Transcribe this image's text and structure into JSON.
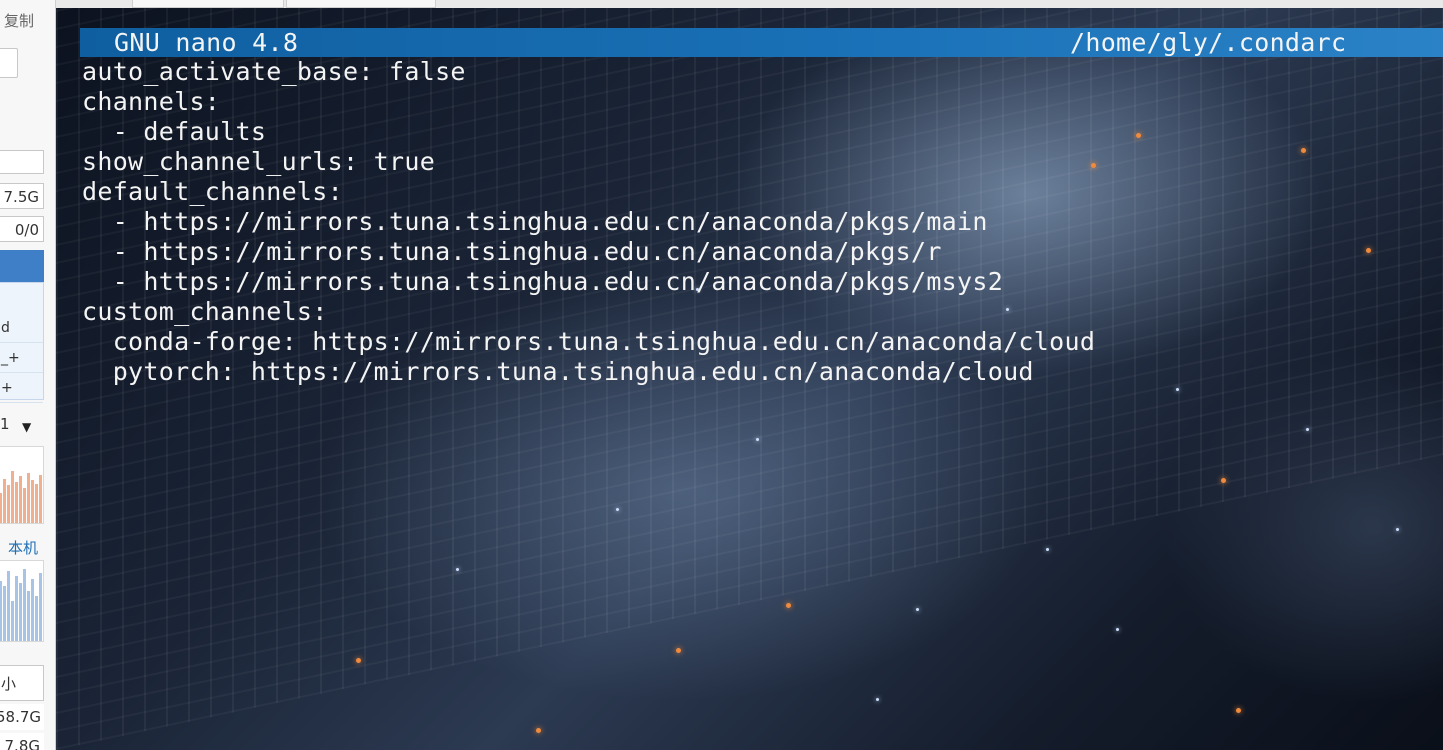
{
  "side_panel": {
    "copy_label": "复制",
    "memory_value": "7.5G",
    "io_value": "0/0",
    "rows": [
      "d",
      "_+",
      "+"
    ],
    "cpu_label": "1",
    "local_label": "本机",
    "disk_header": "小",
    "disk_values": [
      "58.7G",
      "7.8G"
    ],
    "colors": {
      "selected_row": "#3f7fc8",
      "cpu_graph": "#f0b090",
      "net_graph": "#a7c4e6"
    }
  },
  "terminal": {
    "titlebar": {
      "app": "GNU nano 4.8",
      "file": "/home/gly/.condarc",
      "color": "#1b72b8"
    },
    "lines": [
      "auto_activate_base: false",
      "channels:",
      "  - defaults",
      "show_channel_urls: true",
      "default_channels:",
      "  - https://mirrors.tuna.tsinghua.edu.cn/anaconda/pkgs/main",
      "  - https://mirrors.tuna.tsinghua.edu.cn/anaconda/pkgs/r",
      "  - https://mirrors.tuna.tsinghua.edu.cn/anaconda/pkgs/msys2",
      "custom_channels:",
      "  conda-forge: https://mirrors.tuna.tsinghua.edu.cn/anaconda/cloud",
      "  pytorch: https://mirrors.tuna.tsinghua.edu.cn/anaconda/cloud"
    ]
  }
}
